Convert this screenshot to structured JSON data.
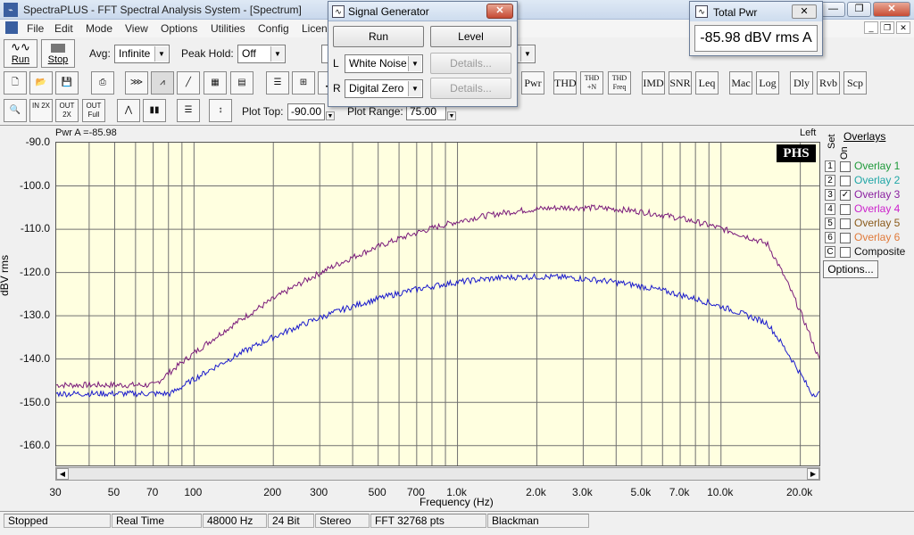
{
  "app": {
    "title": "SpectraPLUS - FFT Spectral Analysis System - [Spectrum]"
  },
  "menu": [
    "File",
    "Edit",
    "Mode",
    "View",
    "Options",
    "Utilities",
    "Config",
    "Licen"
  ],
  "toolbar1": {
    "run_label": "Run",
    "stop_label": "Stop",
    "avg_label": "Avg:",
    "avg_value": "Infinite",
    "peak_hold_label": "Peak Hold:",
    "peak_hold_value": "Off"
  },
  "toolbar2": {
    "text_buttons": [
      "Pwr",
      "THD",
      "THD +N",
      "THD Freq",
      "IMD",
      "SNR",
      "Leq",
      "Mac",
      "Log",
      "Dly",
      "Rvb",
      "Scp"
    ]
  },
  "toolbar3": {
    "zoom_buttons": [
      "IN 2X",
      "OUT 2X",
      "OUT Full"
    ],
    "plot_top_label": "Plot Top:",
    "plot_top_value": "-90.00",
    "plot_range_label": "Plot Range:",
    "plot_range_value": "75.00"
  },
  "graph": {
    "pwr_label": "Pwr A =-85.98",
    "channel_label": "Left",
    "logo": "PHS",
    "y_title": "dBV rms",
    "x_title": "Frequency (Hz)",
    "y_ticks": [
      "-90.0",
      "-100.0",
      "-110.0",
      "-120.0",
      "-130.0",
      "-140.0",
      "-150.0",
      "-160.0"
    ],
    "x_ticks": [
      "30",
      "50",
      "70",
      "100",
      "200",
      "300",
      "500",
      "700",
      "1.0k",
      "2.0k",
      "3.0k",
      "5.0k",
      "7.0k",
      "10.0k",
      "20.0k"
    ]
  },
  "overlays": {
    "header": "Overlays",
    "set_label": "Set",
    "on_label": "On",
    "items": [
      {
        "set": "1",
        "name": "Overlay 1",
        "checked": false,
        "color": "#1e9a3a"
      },
      {
        "set": "2",
        "name": "Overlay 2",
        "checked": false,
        "color": "#1fa6a6"
      },
      {
        "set": "3",
        "name": "Overlay 3",
        "checked": true,
        "color": "#8a1fa0"
      },
      {
        "set": "4",
        "name": "Overlay 4",
        "checked": false,
        "color": "#cc22cc"
      },
      {
        "set": "5",
        "name": "Overlay 5",
        "checked": false,
        "color": "#8a5a1a"
      },
      {
        "set": "6",
        "name": "Overlay 6",
        "checked": false,
        "color": "#e07a3a"
      },
      {
        "set": "C",
        "name": "Composite",
        "checked": false,
        "color": "#111111"
      }
    ],
    "options_label": "Options..."
  },
  "status": [
    "Stopped",
    "Real Time",
    "48000 Hz",
    "24 Bit",
    "Stereo",
    "FFT 32768 pts",
    "Blackman"
  ],
  "signal_generator": {
    "title": "Signal Generator",
    "run_label": "Run",
    "level_label": "Level",
    "l_label": "L",
    "l_value": "White Noise",
    "r_label": "R",
    "r_value": "Digital Zero",
    "details_label": "Details..."
  },
  "total_pwr": {
    "title": "Total Pwr",
    "value": "-85.98 dBV rms A"
  },
  "colors": {
    "plot_bg": "#ffffe0",
    "trace_left": "#1a1acc",
    "trace_overlay": "#7a1a7a"
  }
}
